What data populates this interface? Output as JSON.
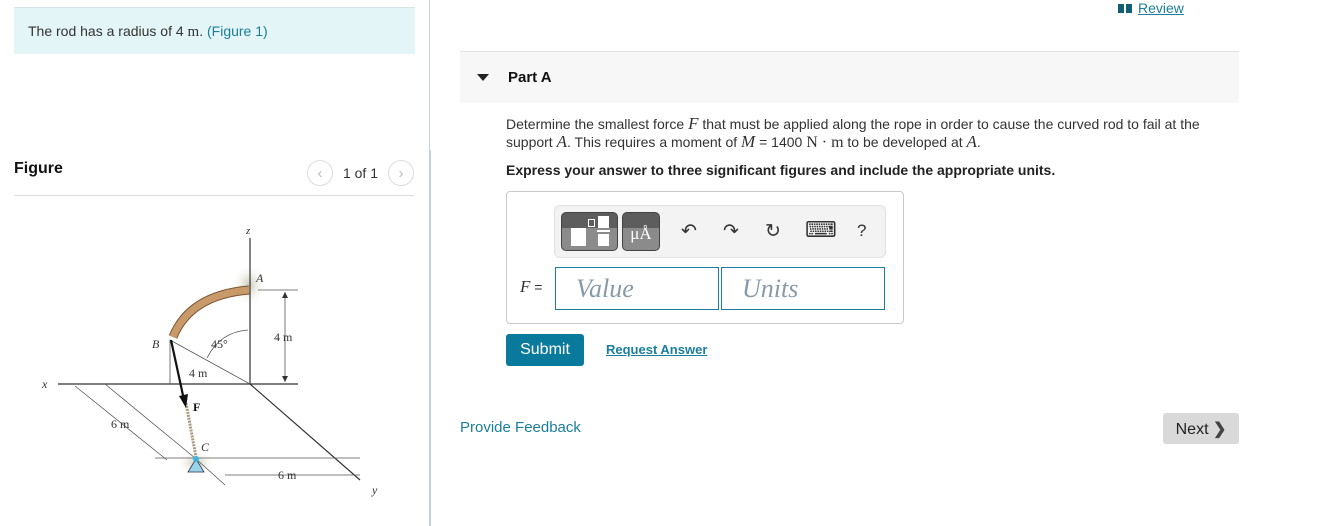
{
  "intro": {
    "text_before": "The rod has a radius of 4 ",
    "unit": "m",
    "text_after": ". ",
    "figure_link": "(Figure 1)"
  },
  "figure_panel": {
    "title": "Figure",
    "pager": "1 of 1",
    "prev_icon": "‹",
    "next_icon": "›",
    "labels": {
      "z": "z",
      "x": "x",
      "y": "y",
      "A": "A",
      "B": "B",
      "C": "C",
      "F": "F",
      "angle": "45°",
      "radius": "4 m",
      "height": "4 m",
      "dist_x": "6 m",
      "dist_y": "6 m"
    }
  },
  "header": {
    "review_label": "Review"
  },
  "part": {
    "title": "Part A",
    "question_1": "Determine the smallest force ",
    "var_F": "F",
    "question_2": " that must be applied along the rope in order to cause the curved rod to fail at the support ",
    "var_A": "A",
    "question_3": ". This requires a moment of ",
    "var_M": "M",
    "question_4": " = 1400 ",
    "unit_Nm": "N · m",
    "question_5": " to be developed at ",
    "var_A2": "A",
    "question_6": ".",
    "instruction": "Express your answer to three significant figures and include the appropriate units."
  },
  "answer": {
    "toolbar": {
      "templates_icon": "templates",
      "units_label": "μÅ",
      "undo_icon": "↶",
      "redo_icon": "↷",
      "reset_icon": "↻",
      "keyboard_icon": "⌨",
      "help_label": "?"
    },
    "var_label": "F",
    "equals": " =",
    "value_placeholder": "Value",
    "units_placeholder": "Units"
  },
  "actions": {
    "submit": "Submit",
    "request_answer": "Request Answer",
    "provide_feedback": "Provide Feedback",
    "next": "Next",
    "next_icon": "❯"
  },
  "colors": {
    "accent": "#1a7e9c",
    "submit_bg": "#0a7a9c",
    "intro_bg": "#e4f5f7",
    "rod": "#c89a6a"
  }
}
